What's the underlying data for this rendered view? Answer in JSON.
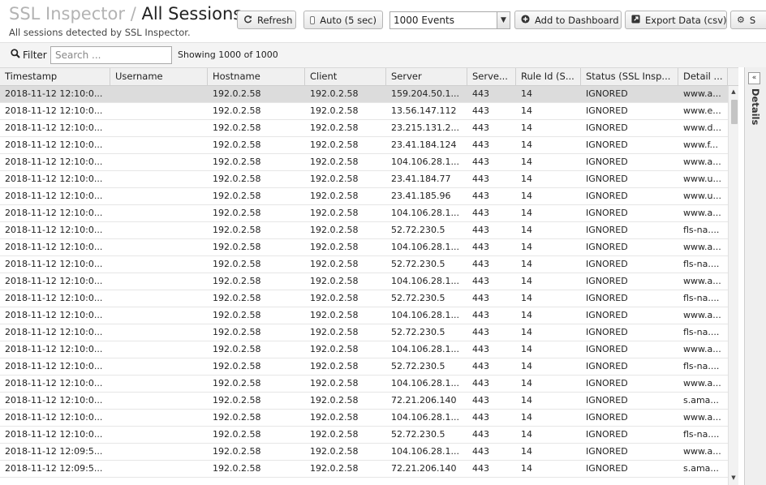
{
  "header": {
    "crumb": "SSL Inspector",
    "separator": "/",
    "title": "All Sessions",
    "subtitle": "All sessions detected by SSL Inspector."
  },
  "toolbar": {
    "refresh_label": "Refresh",
    "auto_label": "Auto (5 sec)",
    "events_select_value": "1000 Events",
    "add_dashboard_label": "Add to Dashboard",
    "export_label": "Export Data (csv)",
    "settings_label": "S"
  },
  "filter": {
    "label": "Filter",
    "placeholder": "Search ...",
    "count_text": "Showing 1000 of 1000"
  },
  "columns": [
    "Timestamp",
    "Username",
    "Hostname",
    "Client",
    "Server",
    "Serve...",
    "Rule Id (S...",
    "Status (SSL Insp...",
    "Detail ..."
  ],
  "rows": [
    [
      "2018-11-12 12:10:0...",
      "",
      "192.0.2.58",
      "192.0.2.58",
      "159.204.50.1...",
      "443",
      "14",
      "IGNORED",
      "www.a..."
    ],
    [
      "2018-11-12 12:10:0...",
      "",
      "192.0.2.58",
      "192.0.2.58",
      "13.56.147.112",
      "443",
      "14",
      "IGNORED",
      "www.e..."
    ],
    [
      "2018-11-12 12:10:0...",
      "",
      "192.0.2.58",
      "192.0.2.58",
      "23.215.131.2...",
      "443",
      "14",
      "IGNORED",
      "www.d..."
    ],
    [
      "2018-11-12 12:10:0...",
      "",
      "192.0.2.58",
      "192.0.2.58",
      "23.41.184.124",
      "443",
      "14",
      "IGNORED",
      "www.f..."
    ],
    [
      "2018-11-12 12:10:0...",
      "",
      "192.0.2.58",
      "192.0.2.58",
      "104.106.28.1...",
      "443",
      "14",
      "IGNORED",
      "www.a..."
    ],
    [
      "2018-11-12 12:10:0...",
      "",
      "192.0.2.58",
      "192.0.2.58",
      "23.41.184.77",
      "443",
      "14",
      "IGNORED",
      "www.u..."
    ],
    [
      "2018-11-12 12:10:0...",
      "",
      "192.0.2.58",
      "192.0.2.58",
      "23.41.185.96",
      "443",
      "14",
      "IGNORED",
      "www.u..."
    ],
    [
      "2018-11-12 12:10:0...",
      "",
      "192.0.2.58",
      "192.0.2.58",
      "104.106.28.1...",
      "443",
      "14",
      "IGNORED",
      "www.a..."
    ],
    [
      "2018-11-12 12:10:0...",
      "",
      "192.0.2.58",
      "192.0.2.58",
      "52.72.230.5",
      "443",
      "14",
      "IGNORED",
      "fls-na...."
    ],
    [
      "2018-11-12 12:10:0...",
      "",
      "192.0.2.58",
      "192.0.2.58",
      "104.106.28.1...",
      "443",
      "14",
      "IGNORED",
      "www.a..."
    ],
    [
      "2018-11-12 12:10:0...",
      "",
      "192.0.2.58",
      "192.0.2.58",
      "52.72.230.5",
      "443",
      "14",
      "IGNORED",
      "fls-na...."
    ],
    [
      "2018-11-12 12:10:0...",
      "",
      "192.0.2.58",
      "192.0.2.58",
      "104.106.28.1...",
      "443",
      "14",
      "IGNORED",
      "www.a..."
    ],
    [
      "2018-11-12 12:10:0...",
      "",
      "192.0.2.58",
      "192.0.2.58",
      "52.72.230.5",
      "443",
      "14",
      "IGNORED",
      "fls-na...."
    ],
    [
      "2018-11-12 12:10:0...",
      "",
      "192.0.2.58",
      "192.0.2.58",
      "104.106.28.1...",
      "443",
      "14",
      "IGNORED",
      "www.a..."
    ],
    [
      "2018-11-12 12:10:0...",
      "",
      "192.0.2.58",
      "192.0.2.58",
      "52.72.230.5",
      "443",
      "14",
      "IGNORED",
      "fls-na...."
    ],
    [
      "2018-11-12 12:10:0...",
      "",
      "192.0.2.58",
      "192.0.2.58",
      "104.106.28.1...",
      "443",
      "14",
      "IGNORED",
      "www.a..."
    ],
    [
      "2018-11-12 12:10:0...",
      "",
      "192.0.2.58",
      "192.0.2.58",
      "52.72.230.5",
      "443",
      "14",
      "IGNORED",
      "fls-na...."
    ],
    [
      "2018-11-12 12:10:0...",
      "",
      "192.0.2.58",
      "192.0.2.58",
      "104.106.28.1...",
      "443",
      "14",
      "IGNORED",
      "www.a..."
    ],
    [
      "2018-11-12 12:10:0...",
      "",
      "192.0.2.58",
      "192.0.2.58",
      "72.21.206.140",
      "443",
      "14",
      "IGNORED",
      "s.ama..."
    ],
    [
      "2018-11-12 12:10:0...",
      "",
      "192.0.2.58",
      "192.0.2.58",
      "104.106.28.1...",
      "443",
      "14",
      "IGNORED",
      "www.a..."
    ],
    [
      "2018-11-12 12:10:0...",
      "",
      "192.0.2.58",
      "192.0.2.58",
      "52.72.230.5",
      "443",
      "14",
      "IGNORED",
      "fls-na...."
    ],
    [
      "2018-11-12 12:09:5...",
      "",
      "192.0.2.58",
      "192.0.2.58",
      "104.106.28.1...",
      "443",
      "14",
      "IGNORED",
      "www.a..."
    ],
    [
      "2018-11-12 12:09:5...",
      "",
      "192.0.2.58",
      "192.0.2.58",
      "72.21.206.140",
      "443",
      "14",
      "IGNORED",
      "s.ama..."
    ]
  ],
  "details_panel": {
    "label": "Details",
    "collapse_icon": "double-chevron-left-icon"
  },
  "icons": {
    "refresh": "refresh-icon",
    "add": "plus-circle-icon",
    "export": "external-link-icon",
    "settings": "gear-icon",
    "filter": "search-icon"
  },
  "colors": {
    "selected_row": "#dcdcdc",
    "header_bg": "#f0f0f0",
    "title_crumb": "#b3b3b3"
  }
}
